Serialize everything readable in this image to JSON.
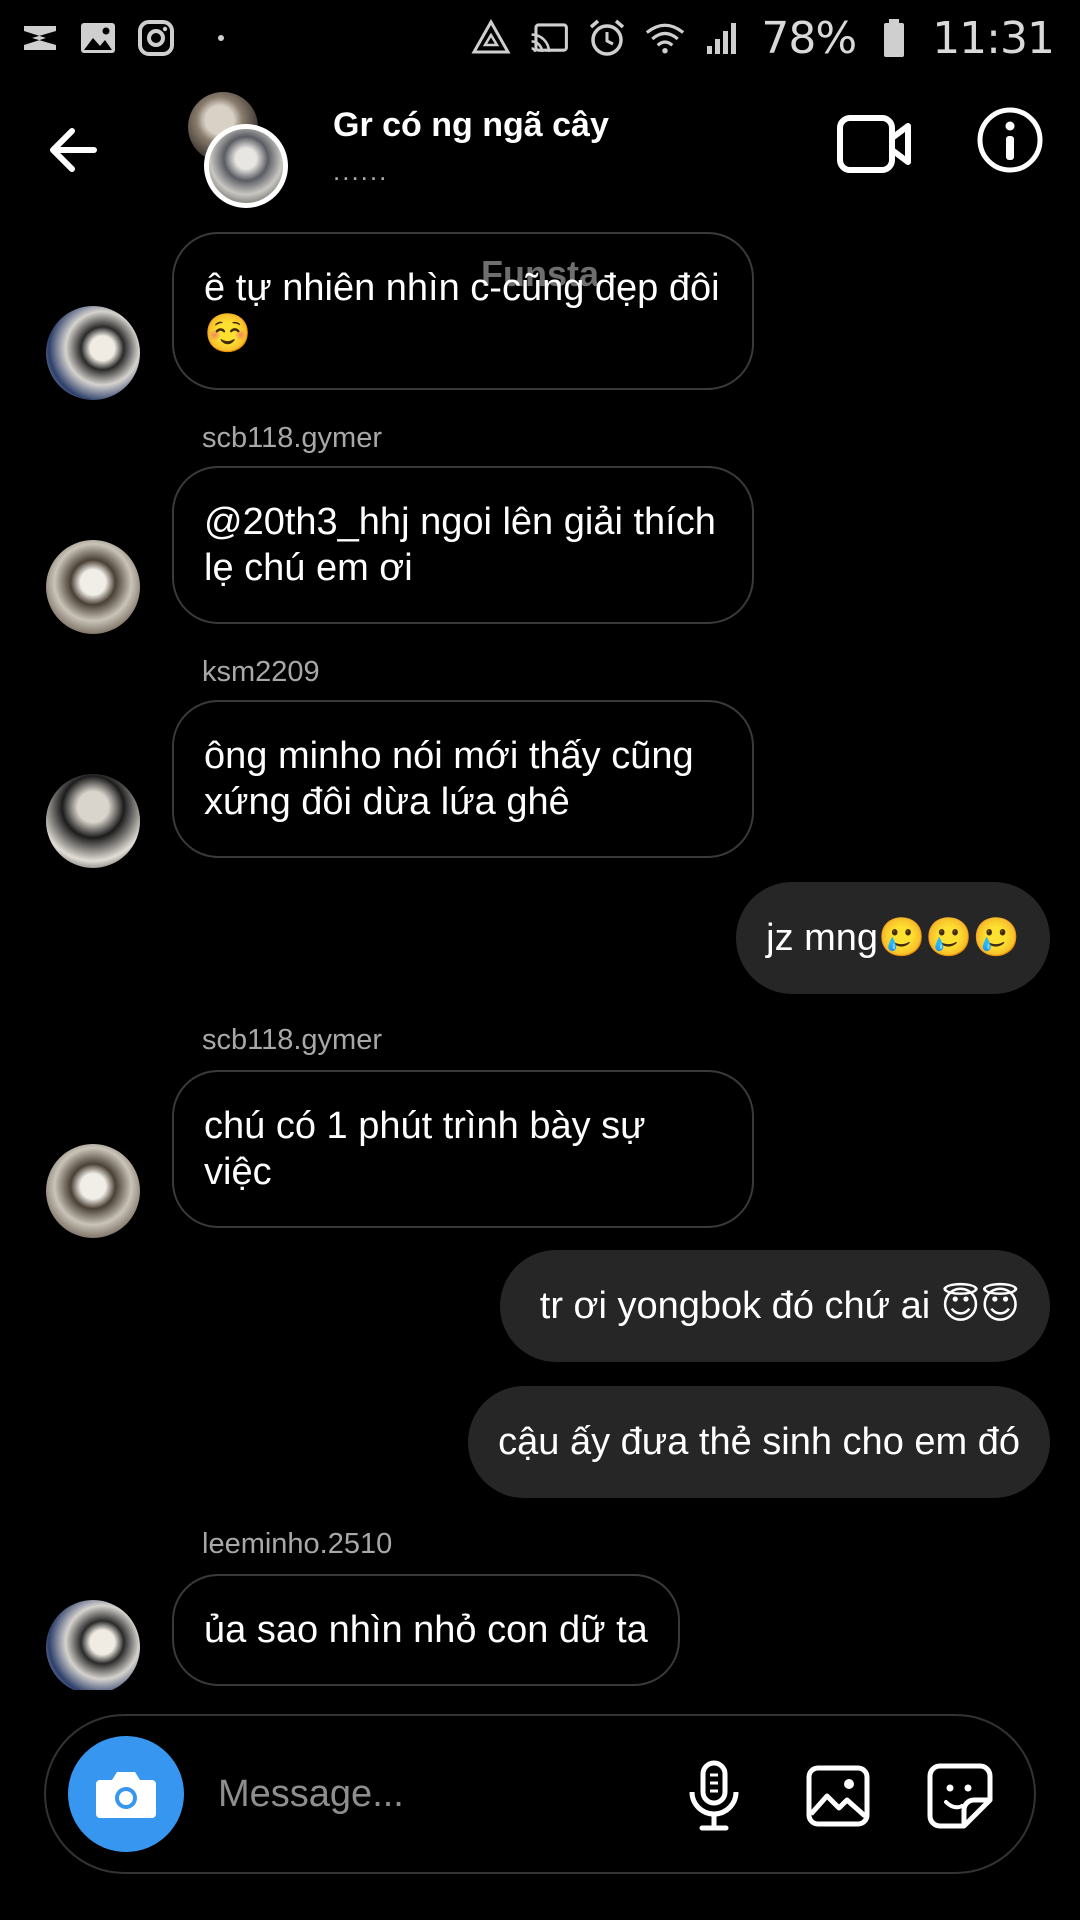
{
  "status_bar": {
    "battery": "78%",
    "time": "11:31",
    "icons": [
      "capcut-icon",
      "gallery-icon",
      "instagram-icon",
      "recycle-icon",
      "cast-icon",
      "alarm-icon",
      "wifi-icon",
      "signal-icon",
      "battery-icon"
    ]
  },
  "header": {
    "title": "Gr có ng ngã cây",
    "subtitle": "......",
    "label": "Funsta"
  },
  "messages": [
    {
      "direction": "in",
      "sender": "",
      "text": "ê tự nhiên nhìn c-cũng đẹp đôi ☺️"
    },
    {
      "direction": "in",
      "sender": "scb118.gymer",
      "text": "@20th3_hhj ngoi lên giải thích lẹ chú em ơi"
    },
    {
      "direction": "in",
      "sender": "ksm2209",
      "text": "ông minho nói mới thấy cũng xứng đôi dừa lứa ghê"
    },
    {
      "direction": "out",
      "sender": "",
      "text": "jz mng🥲🥲🥲"
    },
    {
      "direction": "in",
      "sender": "scb118.gymer",
      "text": "chú có 1 phút trình bày sự việc"
    },
    {
      "direction": "out",
      "sender": "",
      "text": "tr ơi yongbok đó chứ ai 😇😇"
    },
    {
      "direction": "out",
      "sender": "",
      "text": "cậu ấy đưa thẻ sinh cho em đó"
    },
    {
      "direction": "in",
      "sender": "leeminho.2510",
      "text": "ủa sao nhìn nhỏ con dữ ta"
    }
  ],
  "composer": {
    "placeholder": "Message..."
  },
  "colors": {
    "background": "#000000",
    "bubble_out": "#262626",
    "bubble_in_border": "#3a3a3a",
    "camera_button": "#3797f0"
  }
}
